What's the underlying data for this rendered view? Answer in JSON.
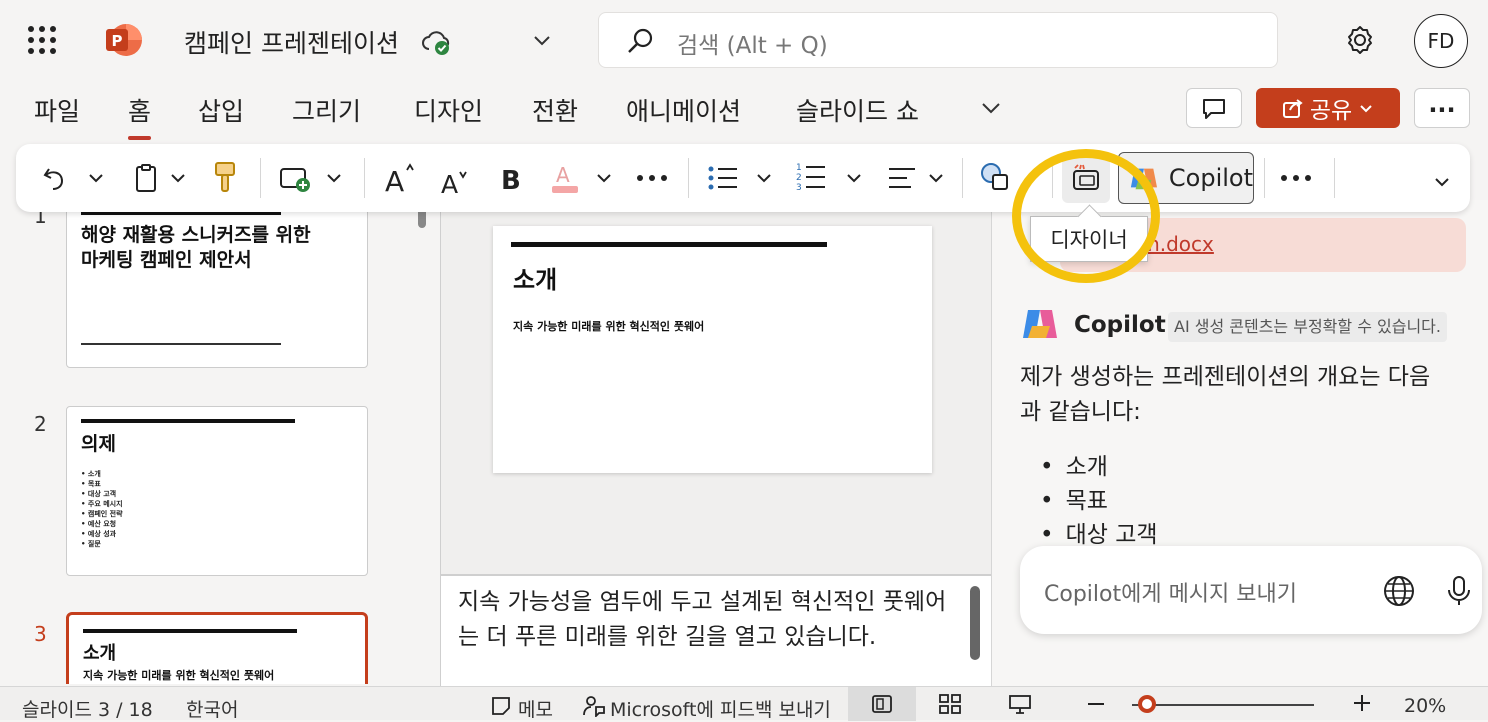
{
  "titlebar": {
    "doc_title": "캠페인 프레젠테이션",
    "search_placeholder": "검색 (Alt + Q)",
    "avatar_initials": "FD"
  },
  "menu": {
    "items": [
      "파일",
      "홈",
      "삽입",
      "그리기",
      "디자인",
      "전환",
      "애니메이션",
      "슬라이드 쇼"
    ],
    "active": "홈",
    "share_label": "공유",
    "overflow_label": "..."
  },
  "ribbon": {
    "copilot_label": "Copilot",
    "tooltip": "디자이너",
    "icons": [
      "undo-icon",
      "clipboard-icon",
      "format-painter-icon",
      "new-slide-icon",
      "increase-font-icon",
      "decrease-font-icon",
      "bold-icon",
      "font-color-icon",
      "more-icon",
      "bullets-icon",
      "numbering-icon",
      "align-icon",
      "shapes-icon",
      "designer-icon",
      "copilot-icon",
      "ribbon-expand-icon"
    ]
  },
  "thumbnails": [
    {
      "num": "1",
      "title": "해양 재활용 스니커즈를 위한\n마케팅 캠페인 제안서"
    },
    {
      "num": "2",
      "title": "의제",
      "bullets": [
        "소개",
        "목표",
        "대상 고객",
        "주요 메시지",
        "캠페인 전략",
        "예산 요청",
        "예상 성과",
        "질문"
      ]
    },
    {
      "num": "3",
      "title": "소개",
      "subtitle": "지속 가능한 미래를 위한 혁신적인 풋웨어",
      "selected": true
    }
  ],
  "main_slide": {
    "title": "소개",
    "subtitle": "지속 가능한 미래를 위한 혁신적인 풋웨어"
  },
  "notes": {
    "text": "지속 가능성을 염두에 두고 설계된 혁신적인 풋웨어는 더 푸른 미래를 위한 길을 열고 있습니다."
  },
  "copilot": {
    "attachment": "...n.docx",
    "name": "Copilot",
    "disclaimer": "AI 생성 콘텐츠는 부정확할 수 있습니다.",
    "message": "제가 생성하는 프레젠테이션의 개요는 다음과 같습니다:",
    "outline": [
      "소개",
      "목표",
      "대상 고객"
    ],
    "input_placeholder": "Copilot에게 메시지 보내기"
  },
  "statusbar": {
    "slide_pos": "슬라이드 3 / 18",
    "language": "한국어",
    "notes_label": "메모",
    "feedback_label": "Microsoft에 피드백 보내기",
    "zoom": "20%",
    "zoom_level": 0.08
  },
  "colors": {
    "accent": "#c43e1c",
    "highlight": "#f4c20d",
    "attachment_bg": "#f7dcd6"
  }
}
